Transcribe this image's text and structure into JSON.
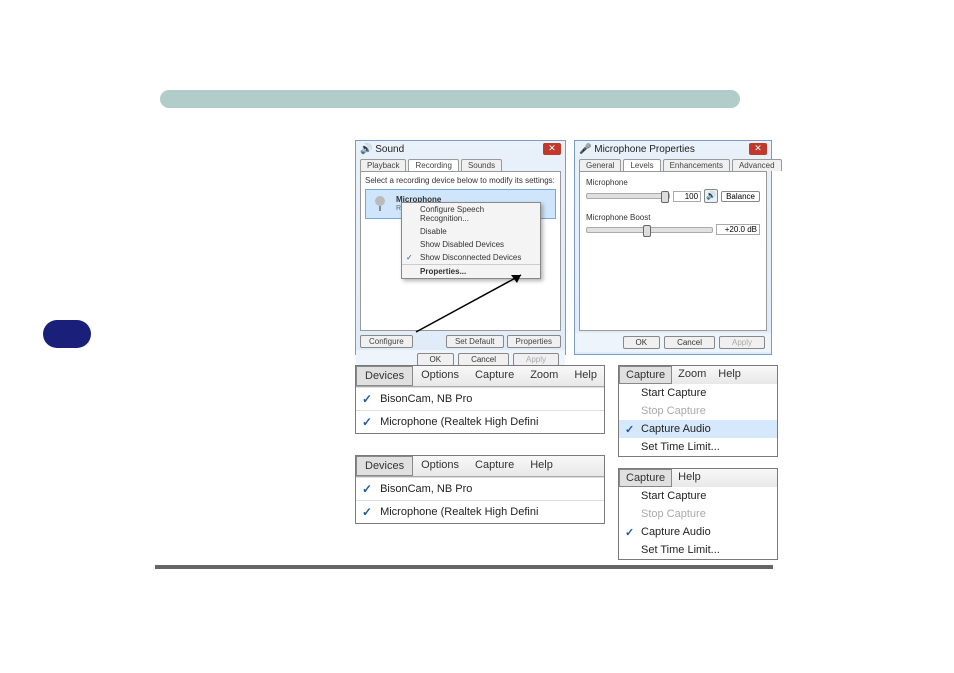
{
  "soundDialog": {
    "title": "Sound",
    "tabs": {
      "playback": "Playback",
      "recording": "Recording",
      "sounds": "Sounds"
    },
    "instruction": "Select a recording device below to modify its settings:",
    "device": {
      "name": "Microphone",
      "driver": "Realtek High Definition Audio"
    },
    "contextMenu": {
      "configure": "Configure Speech Recognition...",
      "disable": "Disable",
      "showDisabled": "Show Disabled Devices",
      "showDisconnected": "Show Disconnected Devices",
      "properties": "Properties..."
    },
    "buttons": {
      "configure": "Configure",
      "setDefault": "Set Default",
      "properties": "Properties"
    },
    "footer": {
      "ok": "OK",
      "cancel": "Cancel",
      "apply": "Apply"
    }
  },
  "micProps": {
    "title": "Microphone Properties",
    "tabs": {
      "general": "General",
      "levels": "Levels",
      "enhancements": "Enhancements",
      "advanced": "Advanced"
    },
    "micLabel": "Microphone",
    "micValue": "100",
    "balance": "Balance",
    "boostLabel": "Microphone Boost",
    "boostValue": "+20.0 dB",
    "footer": {
      "ok": "OK",
      "cancel": "Cancel",
      "apply": "Apply"
    }
  },
  "devMenuA": {
    "tabs": {
      "devices": "Devices",
      "options": "Options",
      "capture": "Capture",
      "zoom": "Zoom",
      "help": "Help"
    },
    "items": {
      "cam": "BisonCam, NB Pro",
      "mic": "Microphone (Realtek High Defini"
    }
  },
  "devMenuB": {
    "tabs": {
      "devices": "Devices",
      "options": "Options",
      "capture": "Capture",
      "help": "Help"
    },
    "items": {
      "cam": "BisonCam, NB Pro",
      "mic": "Microphone (Realtek High Defini"
    }
  },
  "capMenuA": {
    "tabs": {
      "capture": "Capture",
      "zoom": "Zoom",
      "help": "Help"
    },
    "items": {
      "start": "Start Capture",
      "stop": "Stop Capture",
      "audio": "Capture Audio",
      "time": "Set Time Limit..."
    }
  },
  "capMenuB": {
    "tabs": {
      "capture": "Capture",
      "help": "Help"
    },
    "items": {
      "start": "Start Capture",
      "stop": "Stop Capture",
      "audio": "Capture Audio",
      "time": "Set Time Limit..."
    }
  }
}
